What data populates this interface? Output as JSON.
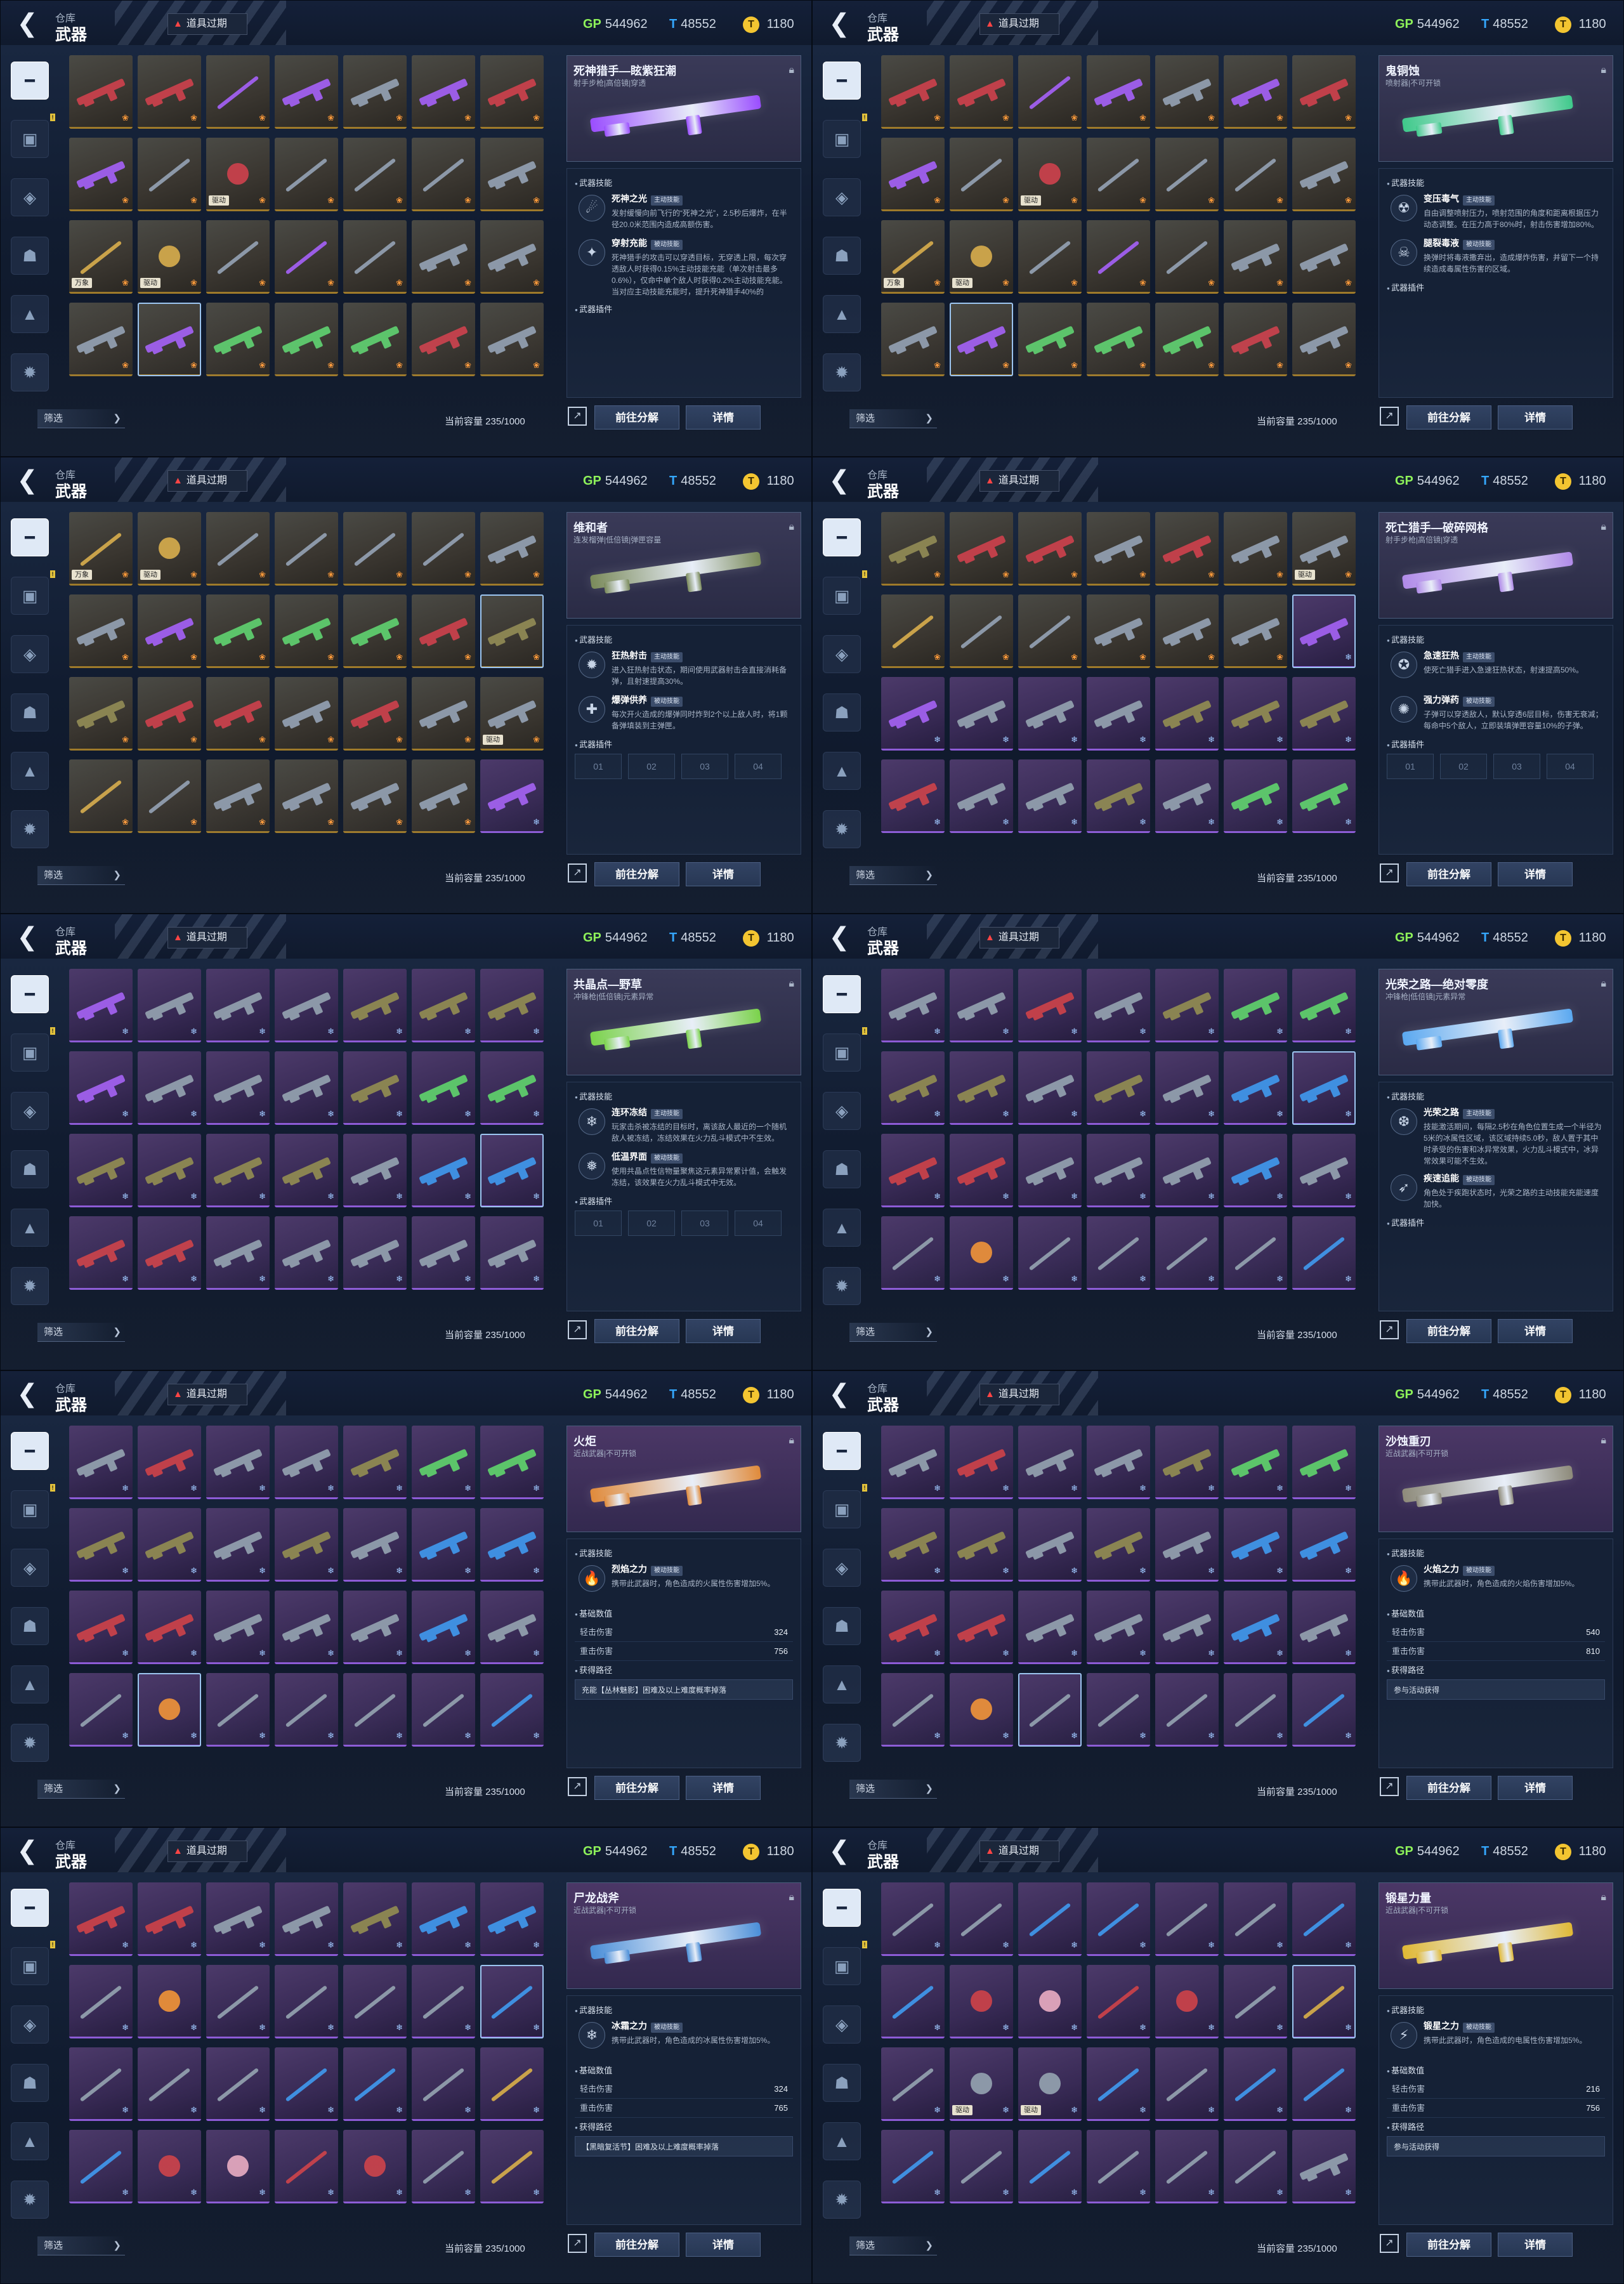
{
  "common": {
    "crumb": "仓库",
    "title": "武器",
    "expire": "道具过期",
    "gp_icon": "GP",
    "gp": "544962",
    "tm_icon": "T",
    "tm": "48552",
    "gold_icon": "T",
    "gold": "1180",
    "filter": "筛选",
    "capacity": "当前容量 235/1000",
    "btn_go": "前往分解",
    "btn_detail": "详情",
    "sec_skill": "武器技能",
    "sec_plugin": "武器插件",
    "sec_stats": "基础数值",
    "sec_route": "获得路径"
  },
  "panels": [
    {
      "selected": 22,
      "cells": [
        "r:red:gold",
        "r:red:gold",
        "b:purple:gold",
        "r:purple:gold",
        "r:steel:gold",
        "r:purple:gold",
        "r:red:gold",
        "r:purple:gold",
        "b:steel:gold",
        "o:red:gold:驱动",
        "b:steel:gold",
        "b:steel:gold",
        "b:steel:gold",
        "r:steel:gold",
        "b:gold:gold:万象",
        "o:gold:gold:驱动",
        "b:steel:gold",
        "b:purple:gold",
        "b:steel:gold",
        "r:steel:gold",
        "r:steel:gold",
        "r:steel:gold",
        "r:purple:gold",
        "r:green:gold",
        "r:green:gold",
        "r:green:gold",
        "r:red:gold",
        "r:steel:gold"
      ],
      "detail": {
        "name": "死神猎手—眩紫狂潮",
        "sub": "射手步枪|高倍镜|穿透",
        "color": "#9a4dff",
        "skills": [
          {
            "icon": "☄",
            "name": "死神之光",
            "badge": "主动技能",
            "desc": "发射缓慢向前飞行的“死神之光”，2.5秒后爆炸，在半径20.0米范围内造成高额伤害。"
          },
          {
            "icon": "✦",
            "name": "穿射充能",
            "badge": "被动技能",
            "desc": "死神猎手的攻击可以穿透目标，无穿透上限，每次穿透敌人时获得0.15%主动技能充能（单次射击最多0.6%），仅命中单个敌人时获得0.2%主动技能充能。当对应主动技能充能时，提升死神猎手40%的"
          }
        ],
        "plugins": [],
        "stats": [],
        "route": ""
      }
    },
    {
      "selected": 22,
      "cells": [
        "r:red:gold",
        "r:red:gold",
        "b:purple:gold",
        "r:purple:gold",
        "r:steel:gold",
        "r:purple:gold",
        "r:red:gold",
        "r:purple:gold",
        "b:steel:gold",
        "o:red:gold:驱动",
        "b:steel:gold",
        "b:steel:gold",
        "b:steel:gold",
        "r:steel:gold",
        "b:gold:gold:万象",
        "o:gold:gold:驱动",
        "b:steel:gold",
        "b:purple:gold",
        "b:steel:gold",
        "r:steel:gold",
        "r:steel:gold",
        "r:steel:gold",
        "r:purple:gold",
        "r:green:gold",
        "r:green:gold",
        "r:green:gold",
        "r:red:gold",
        "r:steel:gold"
      ],
      "detail": {
        "name": "鬼铜蚀",
        "sub": "喷射器|不可开锁",
        "color": "#3ec98a",
        "skills": [
          {
            "icon": "☢",
            "name": "变压毒气",
            "badge": "主动技能",
            "desc": "自由调整喷射压力，喷射范围的角度和距离根据压力动态调整。在压力高于80%时，射击伤害增加80%。"
          },
          {
            "icon": "☠",
            "name": "腿裂毒液",
            "badge": "被动技能",
            "desc": "换弹时将毒液撒弃出，造成爆炸伤害，并留下一个持续造成毒属性伤害的区域。"
          }
        ],
        "plugins": [],
        "stats": [],
        "route": ""
      }
    },
    {
      "selected": 13,
      "cells": [
        "b:gold:gold:万象",
        "o:gold:gold:驱动",
        "b:steel:gold",
        "b:steel:gold",
        "b:steel:gold",
        "b:steel:gold",
        "r:steel:gold",
        "r:steel:gold",
        "r:purple:gold",
        "r:green:gold",
        "r:green:gold",
        "r:green:gold",
        "r:red:gold",
        "r:olive:gold",
        "r:olive:gold",
        "r:red:gold",
        "r:red:gold",
        "r:steel:gold",
        "r:red:gold",
        "r:steel:gold",
        "r:steel:gold:驱动",
        "b:gold:gold",
        "b:steel:gold",
        "r:steel:gold",
        "r:steel:gold",
        "r:steel:gold",
        "r:steel:gold",
        "r:purple:purple"
      ],
      "detail": {
        "name": "维和者",
        "sub": "连发榴弹|低倍镜|弹匣容量",
        "color": "#7a8a5a",
        "skills": [
          {
            "icon": "✹",
            "name": "狂热射击",
            "badge": "主动技能",
            "desc": "进入狂热射击状态，期间使用武器射击会直接消耗备弹，且射速提高30%。"
          },
          {
            "icon": "✚",
            "name": "爆弹供养",
            "badge": "被动技能",
            "desc": "每次开火造成的爆弹同时炸到2个以上敌人时，将1颗备弹填装到主弹匣。"
          }
        ],
        "plugins": [
          "01",
          "02",
          "03",
          "04"
        ],
        "stats": [],
        "route": ""
      }
    },
    {
      "selected": 13,
      "cells": [
        "r:olive:gold",
        "r:red:gold",
        "r:red:gold",
        "r:steel:gold",
        "r:red:gold",
        "r:steel:gold",
        "r:steel:gold:驱动",
        "b:gold:gold",
        "b:steel:gold",
        "b:steel:gold",
        "r:steel:gold",
        "r:steel:gold",
        "r:steel:gold",
        "r:purple:purple",
        "r:purple:purple",
        "r:steel:purple",
        "r:steel:purple",
        "r:steel:purple",
        "r:olive:purple",
        "r:olive:purple",
        "r:olive:purple",
        "r:red:purple",
        "r:steel:purple",
        "r:steel:purple",
        "r:olive:purple",
        "r:steel:purple",
        "r:green:purple",
        "r:green:purple"
      ],
      "detail": {
        "name": "死亡猎手—破碎网格",
        "sub": "射手步枪|高倍镜|穿透",
        "color": "#b08ae8",
        "skills": [
          {
            "icon": "✪",
            "name": "急速狂热",
            "badge": "主动技能",
            "desc": "使死亡猎手进入急速狂热状态，射速提高50%。"
          },
          {
            "icon": "✺",
            "name": "强力弹药",
            "badge": "被动技能",
            "desc": "子弹可以穿透敌人，默认穿透6层目标，伤害无衰减；每命中5个敌人，立即装填弹匣容量10%的子弹。"
          }
        ],
        "plugins": [
          "01",
          "02",
          "03",
          "04"
        ],
        "stats": [],
        "route": ""
      }
    },
    {
      "selected": 20,
      "cells": [
        "r:purple:purple",
        "r:steel:purple",
        "r:steel:purple",
        "r:steel:purple",
        "r:olive:purple",
        "r:olive:purple",
        "r:olive:purple",
        "r:purple:purple",
        "r:steel:purple",
        "r:steel:purple",
        "r:steel:purple",
        "r:olive:purple",
        "r:green:purple",
        "r:green:purple",
        "r:olive:purple",
        "r:olive:purple",
        "r:olive:purple",
        "r:olive:purple",
        "r:steel:purple",
        "r:blue:purple",
        "r:blue:purple",
        "r:red:purple",
        "r:red:purple",
        "r:steel:purple",
        "r:steel:purple",
        "r:steel:purple",
        "r:steel:purple",
        "r:steel:purple"
      ],
      "detail": {
        "name": "共晶点—野草",
        "sub": "冲锋枪|低倍镜|元素异常",
        "color": "#7ad24a",
        "skills": [
          {
            "icon": "❄",
            "name": "连环冻结",
            "badge": "主动技能",
            "desc": "玩家击杀被冻结的目标时，离该敌人最近的一个随机敌人被冻结，冻结效果在火力乱斗模式中不生效。"
          },
          {
            "icon": "❅",
            "name": "低温界面",
            "badge": "被动技能",
            "desc": "使用共晶点性信物量聚焦这元素异常累计值，会触发冻结，该效果在火力乱斗模式中无效。"
          }
        ],
        "plugins": [
          "01",
          "02",
          "03",
          "04"
        ],
        "stats": [],
        "route": ""
      }
    },
    {
      "selected": 13,
      "cells": [
        "r:steel:purple",
        "r:steel:purple",
        "r:red:purple",
        "r:steel:purple",
        "r:olive:purple",
        "r:green:purple",
        "r:green:purple",
        "r:olive:purple",
        "r:olive:purple",
        "r:steel:purple",
        "r:olive:purple",
        "r:steel:purple",
        "r:blue:purple",
        "r:blue:purple",
        "r:red:purple",
        "r:red:purple",
        "r:steel:purple",
        "r:steel:purple",
        "r:steel:purple",
        "r:blue:purple",
        "r:steel:purple",
        "b:steel:purple",
        "o:orange:purple",
        "b:steel:purple",
        "b:steel:purple",
        "b:steel:purple",
        "b:steel:purple",
        "b:blue:purple"
      ],
      "detail": {
        "name": "光荣之路—绝对零度",
        "sub": "冲锋枪|低倍镜|元素异常",
        "color": "#5aa8f0",
        "skills": [
          {
            "icon": "❆",
            "name": "光荣之路",
            "badge": "主动技能",
            "desc": "技能激活期间，每隔2.5秒在角色位置生成一个半径为5米的冰属性区域，该区域持续5.0秒，敌人置于其中时承受的伤害和冰异常效果，火力乱斗模式中，冰异常效果可能不生效。"
          },
          {
            "icon": "➶",
            "name": "疾速追能",
            "badge": "被动技能",
            "desc": "角色处于疾跑状态时，光荣之路的主动技能充能速度加快。"
          }
        ],
        "plugins": [],
        "stats": [],
        "route": ""
      }
    },
    {
      "selected": 22,
      "cells": [
        "r:steel:purple",
        "r:red:purple",
        "r:steel:purple",
        "r:steel:purple",
        "r:olive:purple",
        "r:green:purple",
        "r:green:purple",
        "r:olive:purple",
        "r:olive:purple",
        "r:steel:purple",
        "r:olive:purple",
        "r:steel:purple",
        "r:blue:purple",
        "r:blue:purple",
        "r:red:purple",
        "r:red:purple",
        "r:steel:purple",
        "r:steel:purple",
        "r:steel:purple",
        "r:blue:purple",
        "r:steel:purple",
        "b:steel:purple",
        "o:orange:purple",
        "b:steel:purple",
        "b:steel:purple",
        "b:steel:purple",
        "b:steel:purple",
        "b:blue:purple"
      ],
      "detail": {
        "name": "火炬",
        "sub": "近战武器|不可开锁",
        "color": "#e08a3a",
        "skills": [
          {
            "icon": "🔥",
            "name": "烈焰之力",
            "badge": "被动技能",
            "desc": "携带此武器时，角色造成的火属性伤害增加5%。"
          }
        ],
        "plugins": [],
        "stats": [
          {
            "label": "轻击伤害",
            "value": "324"
          },
          {
            "label": "重击伤害",
            "value": "756"
          }
        ],
        "route": "充能【丛林魅影】困难及以上难度概率掉落"
      }
    },
    {
      "selected": 23,
      "cells": [
        "r:steel:purple",
        "r:red:purple",
        "r:steel:purple",
        "r:steel:purple",
        "r:olive:purple",
        "r:green:purple",
        "r:green:purple",
        "r:olive:purple",
        "r:olive:purple",
        "r:steel:purple",
        "r:olive:purple",
        "r:steel:purple",
        "r:blue:purple",
        "r:blue:purple",
        "r:red:purple",
        "r:red:purple",
        "r:steel:purple",
        "r:steel:purple",
        "r:steel:purple",
        "r:blue:purple",
        "r:steel:purple",
        "b:steel:purple",
        "o:orange:purple",
        "b:steel:purple",
        "b:steel:purple",
        "b:steel:purple",
        "b:steel:purple",
        "b:blue:purple"
      ],
      "detail": {
        "name": "沙蚀重刃",
        "sub": "近战武器|不可开锁",
        "color": "#8d8a7a",
        "skills": [
          {
            "icon": "🔥",
            "name": "火焰之力",
            "badge": "被动技能",
            "desc": "携带此武器时，角色造成的火焰伤害增加5%。"
          }
        ],
        "plugins": [],
        "stats": [
          {
            "label": "轻击伤害",
            "value": "540"
          },
          {
            "label": "重击伤害",
            "value": "810"
          }
        ],
        "route": "参与活动获得"
      }
    },
    {
      "selected": 13,
      "cells": [
        "r:red:purple",
        "r:red:purple",
        "r:steel:purple",
        "r:steel:purple",
        "r:olive:purple",
        "r:blue:purple",
        "r:blue:purple",
        "b:steel:purple",
        "o:orange:purple",
        "b:steel:purple",
        "b:steel:purple",
        "b:steel:purple",
        "b:steel:purple",
        "b:blue:purple",
        "b:steel:purple",
        "b:steel:purple",
        "b:steel:purple",
        "b:blue:purple",
        "b:blue:purple",
        "b:steel:purple",
        "b:gold:purple",
        "b:blue:purple",
        "o:red:purple",
        "o:pink:purple",
        "b:red:purple",
        "o:red:purple",
        "b:steel:purple",
        "b:gold:purple"
      ],
      "detail": {
        "name": "尸龙战斧",
        "sub": "近战武器|不可开锁",
        "color": "#4a8ed8",
        "skills": [
          {
            "icon": "❄",
            "name": "冰霜之力",
            "badge": "被动技能",
            "desc": "携带此武器时，角色造成的冰属性伤害增加5%。"
          }
        ],
        "plugins": [],
        "stats": [
          {
            "label": "轻击伤害",
            "value": "324"
          },
          {
            "label": "重击伤害",
            "value": "765"
          }
        ],
        "route": "【黑暗复活节】困难及以上难度概率掉落"
      }
    },
    {
      "selected": 13,
      "cells": [
        "b:steel:purple",
        "b:steel:purple",
        "b:blue:purple",
        "b:blue:purple",
        "b:steel:purple",
        "b:steel:purple",
        "b:blue:purple",
        "b:blue:purple",
        "o:red:purple",
        "o:pink:purple",
        "b:red:purple",
        "o:red:purple",
        "b:steel:purple",
        "b:gold:purple",
        "b:steel:purple",
        "o:steel:purple:驱动",
        "o:steel:purple:驱动",
        "b:blue:purple",
        "b:steel:purple",
        "b:blue:purple",
        "b:blue:purple",
        "b:blue:purple",
        "b:steel:purple",
        "b:blue:purple",
        "b:steel:purple",
        "b:steel:purple",
        "b:steel:purple",
        "r:steel:purple"
      ],
      "detail": {
        "name": "锻星力量",
        "sub": "近战武器|不可开锁",
        "color": "#e0b834",
        "skills": [
          {
            "icon": "⚡",
            "name": "锻星之力",
            "badge": "被动技能",
            "desc": "携带此武器时，角色造成的电属性伤害增加5%。"
          }
        ],
        "plugins": [],
        "stats": [
          {
            "label": "轻击伤害",
            "value": "216"
          },
          {
            "label": "重击伤害",
            "value": "756"
          }
        ],
        "route": "参与活动获得"
      }
    }
  ],
  "colors": {
    "red": "#c0404a",
    "purple": "#9b5de5",
    "steel": "#8c98a8",
    "gold": "#c9a24a",
    "green": "#5cc46a",
    "olive": "#8a8452",
    "blue": "#3f8fe0",
    "orange": "#e08a3a",
    "pink": "#d9a0b8"
  },
  "sidebar_icons": [
    "gun-icon",
    "grenade-icon",
    "shield-icon",
    "armor-icon",
    "badge-icon",
    "star-icon"
  ]
}
